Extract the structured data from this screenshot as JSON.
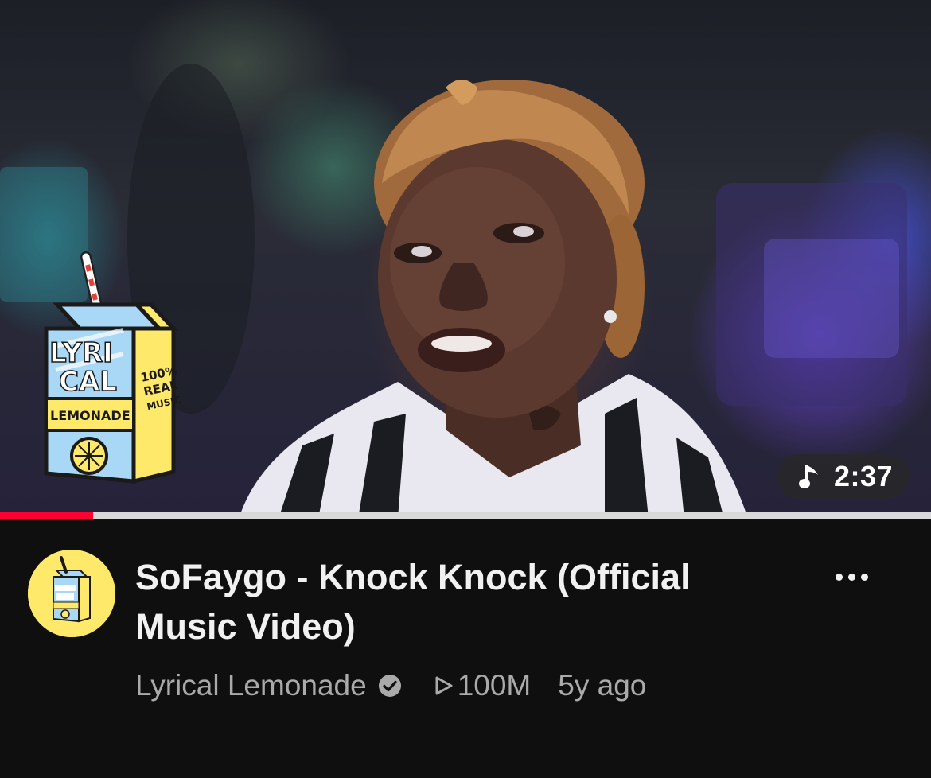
{
  "video": {
    "title": "SoFaygo - Knock Knock (Official Music Video)",
    "duration": "2:37",
    "duration_icon": "music-note-icon",
    "watch_progress": 0.1
  },
  "channel": {
    "name": "Lyrical Lemonade",
    "verified_icon": "verified-check-icon"
  },
  "stats": {
    "views": "100M",
    "views_icon": "play-outline-icon",
    "age": "5y ago"
  },
  "logo": {
    "line1": "LYRI",
    "line2": "CAL",
    "band": "LEMONADE",
    "side_line1": "100%",
    "side_line2": "REAL",
    "side_line3": "MUSIC"
  },
  "colors": {
    "background": "#0f0f0f",
    "progress": "#ff0033",
    "title_text": "#f1f1f1",
    "meta_text": "#aaaaaa",
    "logo_yellow": "#ffe96a",
    "logo_blue": "#a8d8f5"
  }
}
